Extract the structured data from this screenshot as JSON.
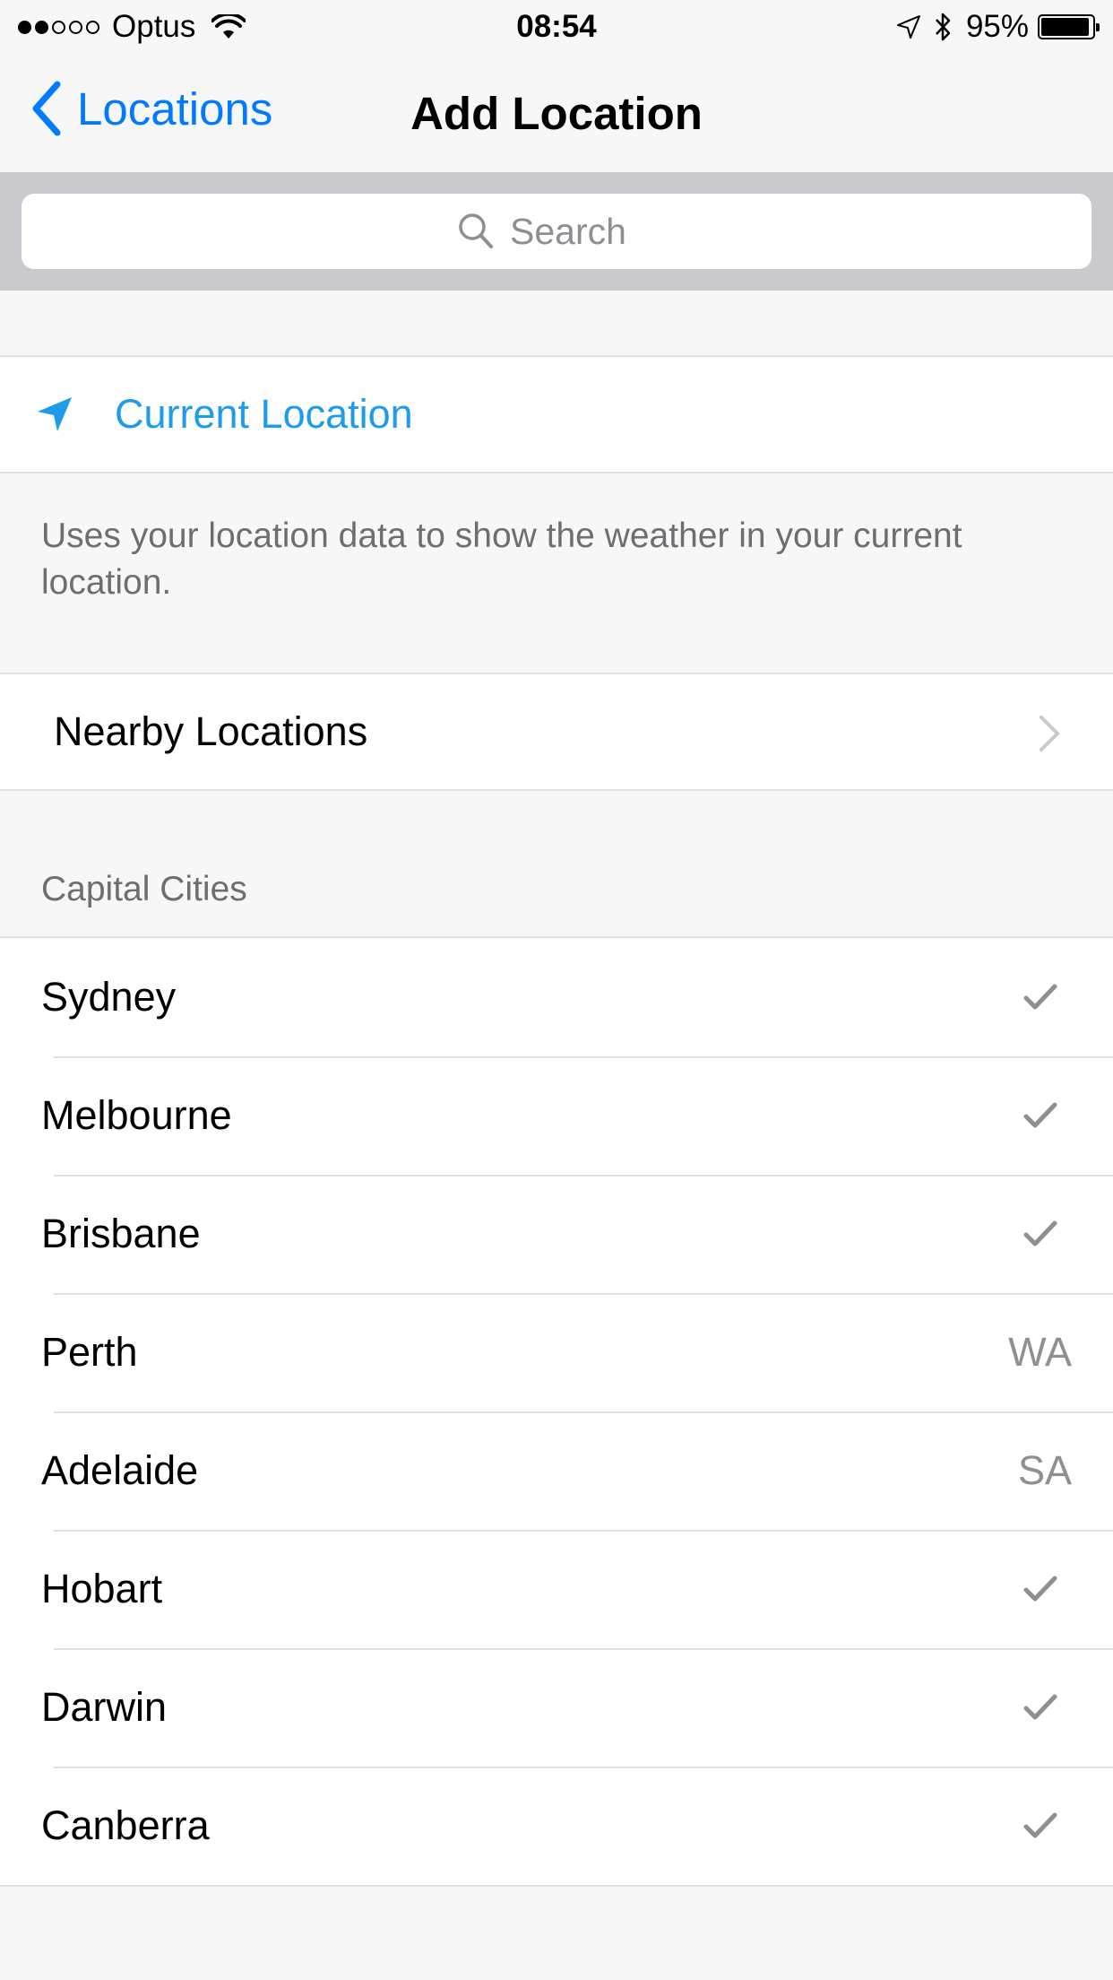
{
  "status_bar": {
    "signal_filled": 2,
    "signal_total": 5,
    "carrier": "Optus",
    "time": "08:54",
    "battery_percent": "95%",
    "battery_level": 0.95
  },
  "nav": {
    "back_label": "Locations",
    "title": "Add Location"
  },
  "search": {
    "placeholder": "Search"
  },
  "current_location": {
    "label": "Current Location",
    "note": "Uses your location data to show the weather in your current location."
  },
  "nearby": {
    "label": "Nearby Locations"
  },
  "capital_cities": {
    "header": "Capital Cities",
    "items": [
      {
        "name": "Sydney",
        "checked": true,
        "state": ""
      },
      {
        "name": "Melbourne",
        "checked": true,
        "state": ""
      },
      {
        "name": "Brisbane",
        "checked": true,
        "state": ""
      },
      {
        "name": "Perth",
        "checked": false,
        "state": "WA"
      },
      {
        "name": "Adelaide",
        "checked": false,
        "state": "SA"
      },
      {
        "name": "Hobart",
        "checked": true,
        "state": ""
      },
      {
        "name": "Darwin",
        "checked": true,
        "state": ""
      },
      {
        "name": "Canberra",
        "checked": true,
        "state": ""
      }
    ]
  },
  "colors": {
    "accent": "#007aff",
    "location_blue": "#1e9be9",
    "secondary_text": "#6d6d72",
    "checkmark": "#8e8e93"
  }
}
